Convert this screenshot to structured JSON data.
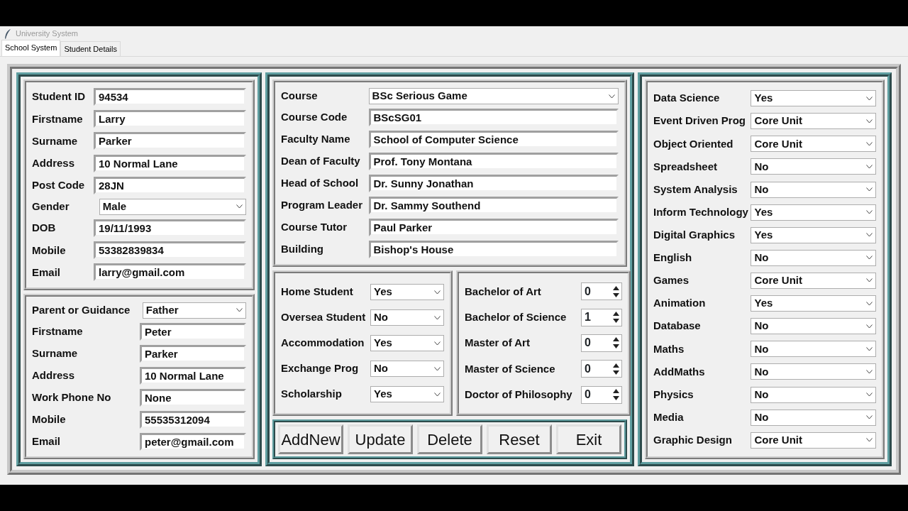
{
  "window": {
    "title": "University System"
  },
  "tabs": [
    {
      "label": "School System",
      "selected": true
    },
    {
      "label": "Student Details",
      "selected": false
    }
  ],
  "student": [
    {
      "label": "Student ID",
      "kind": "entry",
      "value": "94534"
    },
    {
      "label": "Firstname",
      "kind": "entry",
      "value": "Larry"
    },
    {
      "label": "Surname",
      "kind": "entry",
      "value": "Parker"
    },
    {
      "label": "Address",
      "kind": "entry",
      "value": "10 Normal Lane"
    },
    {
      "label": "Post Code",
      "kind": "entry",
      "value": "28JN"
    },
    {
      "label": "Gender",
      "kind": "combo",
      "value": "Male"
    },
    {
      "label": "DOB",
      "kind": "entry",
      "value": "19/11/1993"
    },
    {
      "label": "Mobile",
      "kind": "entry",
      "value": "53382839834"
    },
    {
      "label": "Email",
      "kind": "entry",
      "value": "larry@gmail.com"
    }
  ],
  "parent": [
    {
      "label": "Parent or Guidance",
      "kind": "combo",
      "value": "Father"
    },
    {
      "label": "Firstname",
      "kind": "entry",
      "value": "Peter"
    },
    {
      "label": "Surname",
      "kind": "entry",
      "value": "Parker"
    },
    {
      "label": "Address",
      "kind": "entry",
      "value": "10 Normal Lane"
    },
    {
      "label": "Work Phone No",
      "kind": "entry",
      "value": "None"
    },
    {
      "label": "Mobile",
      "kind": "entry",
      "value": "55535312094"
    },
    {
      "label": "Email",
      "kind": "entry",
      "value": "peter@gmail.com"
    }
  ],
  "course": [
    {
      "label": "Course",
      "kind": "combo",
      "value": "BSc Serious Game"
    },
    {
      "label": "Course Code",
      "kind": "entry",
      "value": "BScSG01"
    },
    {
      "label": "Faculty Name",
      "kind": "entry",
      "value": "School of Computer Science"
    },
    {
      "label": "Dean of Faculty",
      "kind": "entry",
      "value": "Prof. Tony Montana"
    },
    {
      "label": "Head of School",
      "kind": "entry",
      "value": "Dr. Sunny Jonathan"
    },
    {
      "label": "Program Leader",
      "kind": "entry",
      "value": "Dr. Sammy Southend"
    },
    {
      "label": "Course Tutor",
      "kind": "entry",
      "value": "Paul Parker"
    },
    {
      "label": "Building",
      "kind": "entry",
      "value": "Bishop's House"
    }
  ],
  "status": [
    {
      "label": "Home Student",
      "kind": "combo",
      "value": "Yes"
    },
    {
      "label": "Oversea Student",
      "kind": "combo",
      "value": "No"
    },
    {
      "label": "Accommodation",
      "kind": "combo",
      "value": "Yes"
    },
    {
      "label": "Exchange Prog",
      "kind": "combo",
      "value": "No"
    },
    {
      "label": "Scholarship",
      "kind": "combo",
      "value": "Yes"
    }
  ],
  "degrees": [
    {
      "label": "Bachelor of Art",
      "kind": "spin",
      "value": "0"
    },
    {
      "label": "Bachelor of Science",
      "kind": "spin",
      "value": "1"
    },
    {
      "label": "Master of Art",
      "kind": "spin",
      "value": "0"
    },
    {
      "label": "Master of Science",
      "kind": "spin",
      "value": "0"
    },
    {
      "label": "Doctor of Philosophy",
      "kind": "spin",
      "value": "0"
    }
  ],
  "buttons": [
    "AddNew",
    "Update",
    "Delete",
    "Reset",
    "Exit"
  ],
  "units": [
    {
      "label": "Data Science",
      "kind": "combo",
      "value": "Yes"
    },
    {
      "label": "Event Driven Prog",
      "kind": "combo",
      "value": "Core Unit"
    },
    {
      "label": "Object Oriented",
      "kind": "combo",
      "value": "Core Unit"
    },
    {
      "label": "Spreadsheet",
      "kind": "combo",
      "value": "No"
    },
    {
      "label": "System Analysis",
      "kind": "combo",
      "value": "No"
    },
    {
      "label": "Inform Technology",
      "kind": "combo",
      "value": "Yes"
    },
    {
      "label": "Digital Graphics",
      "kind": "combo",
      "value": "Yes"
    },
    {
      "label": "English",
      "kind": "combo",
      "value": "No"
    },
    {
      "label": "Games",
      "kind": "combo",
      "value": "Core Unit"
    },
    {
      "label": "Animation",
      "kind": "combo",
      "value": "Yes"
    },
    {
      "label": "Database",
      "kind": "combo",
      "value": "No"
    },
    {
      "label": "Maths",
      "kind": "combo",
      "value": "No"
    },
    {
      "label": "AddMaths",
      "kind": "combo",
      "value": "No"
    },
    {
      "label": "Physics",
      "kind": "combo",
      "value": "No"
    },
    {
      "label": "Media",
      "kind": "combo",
      "value": "No"
    },
    {
      "label": "Graphic Design",
      "kind": "combo",
      "value": "Core Unit"
    }
  ]
}
